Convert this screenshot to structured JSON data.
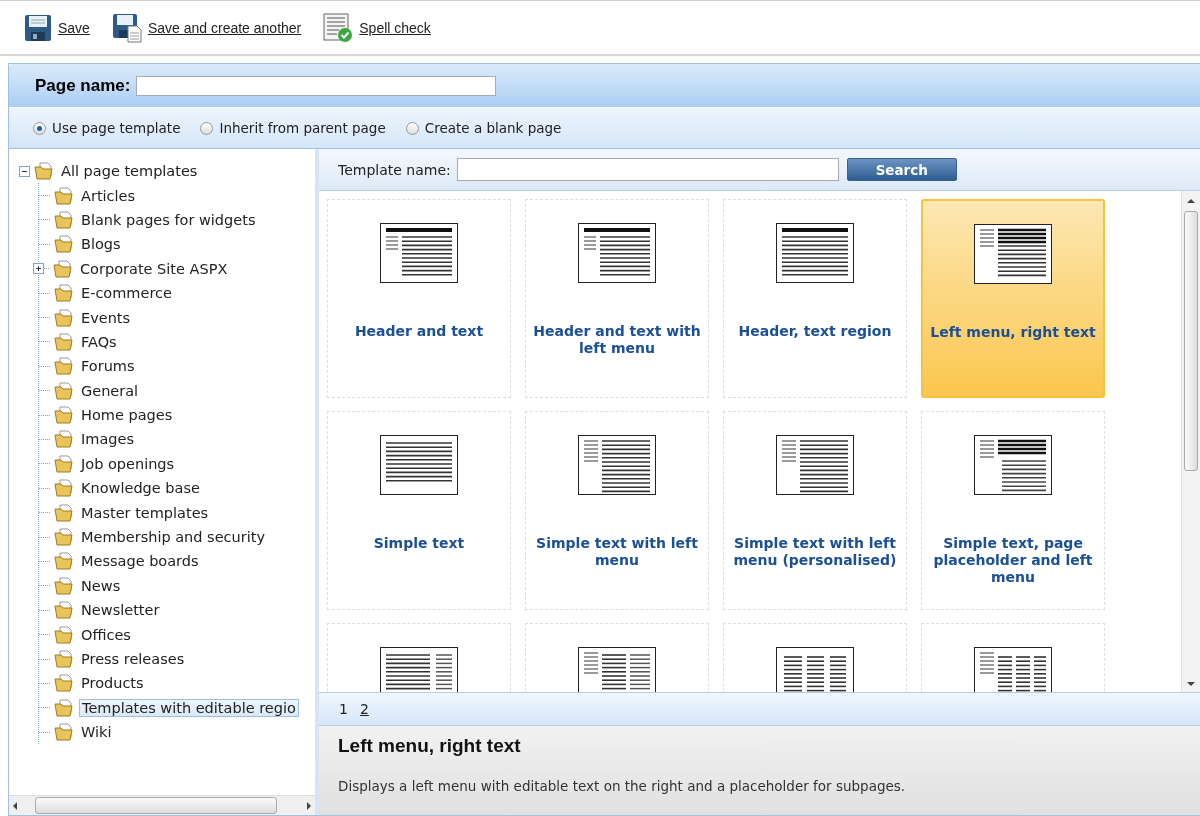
{
  "toolbar": [
    {
      "kind": "save",
      "label": "Save"
    },
    {
      "kind": "save-another",
      "label": "Save and create another"
    },
    {
      "kind": "spell",
      "label": "Spell check"
    }
  ],
  "page_name": {
    "label": "Page name:"
  },
  "options": [
    {
      "label": "Use page template",
      "selected": true
    },
    {
      "label": "Inherit from parent page",
      "selected": false
    },
    {
      "label": "Create a blank page",
      "selected": false
    }
  ],
  "tree": {
    "label": "All page templates",
    "expanded": true,
    "selected": false,
    "children": [
      {
        "label": "Articles",
        "collapsed": false,
        "selected": false
      },
      {
        "label": "Blank pages for widgets",
        "collapsed": false,
        "selected": false
      },
      {
        "label": "Blogs",
        "collapsed": false,
        "selected": false
      },
      {
        "label": "Corporate Site ASPX",
        "collapsed": true,
        "selected": false
      },
      {
        "label": "E-commerce",
        "collapsed": false,
        "selected": false
      },
      {
        "label": "Events",
        "collapsed": false,
        "selected": false
      },
      {
        "label": "FAQs",
        "collapsed": false,
        "selected": false
      },
      {
        "label": "Forums",
        "collapsed": false,
        "selected": false
      },
      {
        "label": "General",
        "collapsed": false,
        "selected": false
      },
      {
        "label": "Home pages",
        "collapsed": false,
        "selected": false
      },
      {
        "label": "Images",
        "collapsed": false,
        "selected": false
      },
      {
        "label": "Job openings",
        "collapsed": false,
        "selected": false
      },
      {
        "label": "Knowledge base",
        "collapsed": false,
        "selected": false
      },
      {
        "label": "Master templates",
        "collapsed": false,
        "selected": false
      },
      {
        "label": "Membership and security",
        "collapsed": false,
        "selected": false
      },
      {
        "label": "Message boards",
        "collapsed": false,
        "selected": false
      },
      {
        "label": "News",
        "collapsed": false,
        "selected": false
      },
      {
        "label": "Newsletter",
        "collapsed": false,
        "selected": false
      },
      {
        "label": "Offices",
        "collapsed": false,
        "selected": false
      },
      {
        "label": "Press releases",
        "collapsed": false,
        "selected": false
      },
      {
        "label": "Products",
        "collapsed": false,
        "selected": false
      },
      {
        "label": "Templates with editable regio",
        "collapsed": false,
        "selected": true
      },
      {
        "label": "Wiki",
        "collapsed": false,
        "selected": false
      }
    ]
  },
  "search": {
    "label": "Template name:",
    "button": "Search"
  },
  "templates": [
    {
      "name": "Header and text",
      "kind": "header-menu",
      "selected": false
    },
    {
      "name": "Header and text with left menu",
      "kind": "header-menu",
      "selected": false
    },
    {
      "name": "Header, text region",
      "kind": "header-full",
      "selected": false
    },
    {
      "name": "Left menu, right text",
      "kind": "menu-bold",
      "selected": true
    },
    {
      "name": "Simple text",
      "kind": "full",
      "selected": false
    },
    {
      "name": "Simple text with left menu",
      "kind": "menu",
      "selected": false
    },
    {
      "name": "Simple text with left menu (personalised)",
      "kind": "menu",
      "selected": false
    },
    {
      "name": "Simple text, page placeholder and left menu",
      "kind": "menu-placeholder",
      "selected": false
    },
    {
      "kind": "right-menu",
      "selected": false
    },
    {
      "kind": "menu-two-col",
      "selected": false
    },
    {
      "kind": "three-col",
      "selected": false
    },
    {
      "kind": "menu-three-col",
      "selected": false
    }
  ],
  "pages": [
    {
      "label": "1",
      "selected": true
    },
    {
      "label": "2",
      "selected": false
    }
  ],
  "detail": {
    "title": "Left menu, right text",
    "description": "Displays a left menu with editable text on the right and a placeholder for subpages."
  }
}
